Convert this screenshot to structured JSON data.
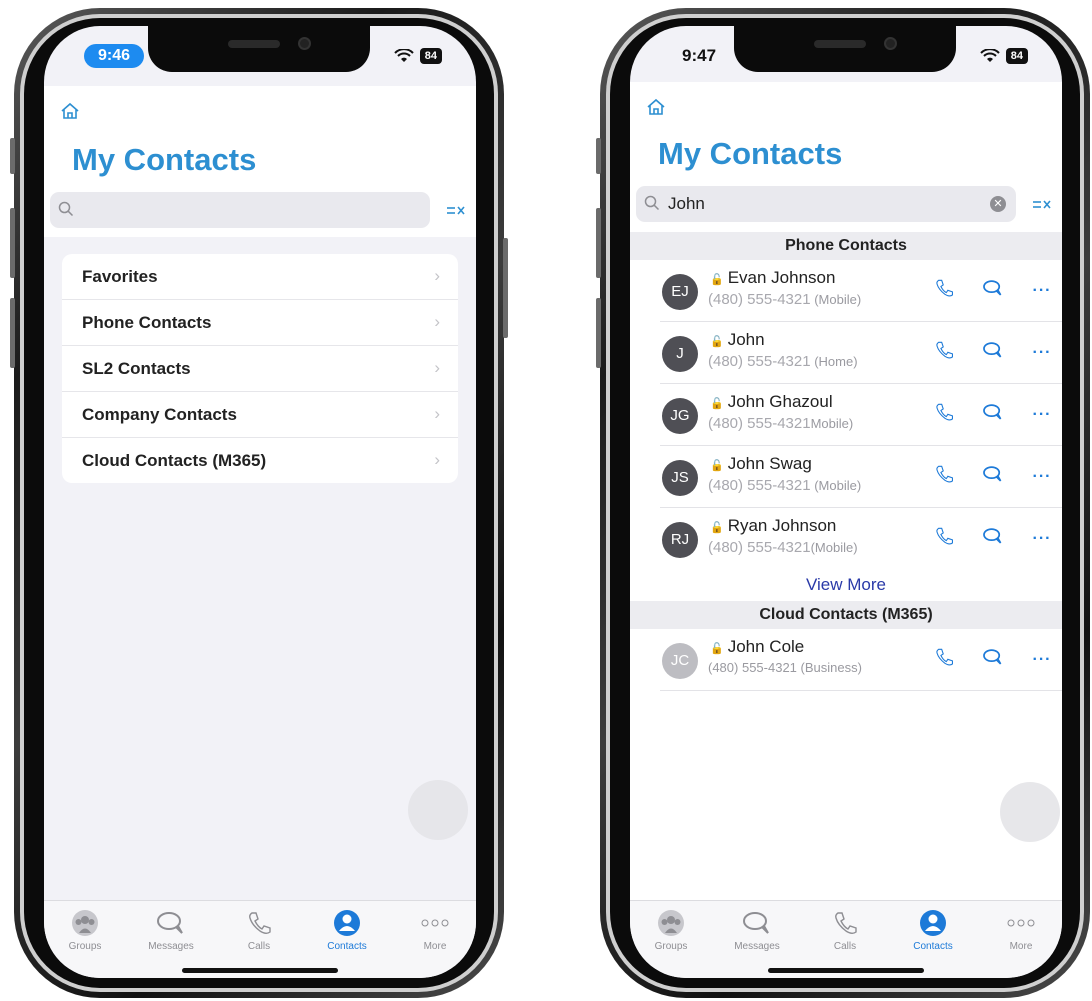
{
  "left_phone": {
    "status": {
      "time": "9:46",
      "battery": "84"
    },
    "title": "My Contacts",
    "search": {
      "value": ""
    },
    "menu": [
      {
        "label": "Favorites"
      },
      {
        "label": "Phone Contacts"
      },
      {
        "label": "SL2 Contacts"
      },
      {
        "label": "Company Contacts"
      },
      {
        "label": "Cloud Contacts (M365)"
      }
    ]
  },
  "right_phone": {
    "status": {
      "time": "9:47",
      "battery": "84"
    },
    "title": "My Contacts",
    "search": {
      "value": "John"
    },
    "sections": [
      {
        "title": "Phone Contacts",
        "contacts": [
          {
            "initials": "EJ",
            "name": "Evan Johnson",
            "phone": "(480) 555-4321",
            "type": "(Mobile)"
          },
          {
            "initials": "J",
            "name": "John",
            "phone": "(480) 555-4321",
            "type": "(Home)"
          },
          {
            "initials": "JG",
            "name": "John Ghazoul",
            "phone": "(480) 555-4321",
            "type": "Mobile)"
          },
          {
            "initials": "JS",
            "name": "John Swag",
            "phone": "(480) 555-4321",
            "type": "(Mobile)"
          },
          {
            "initials": "RJ",
            "name": "Ryan Johnson",
            "phone": "(480) 555-4321",
            "type": "(Mobile)"
          }
        ],
        "view_more": "View More"
      },
      {
        "title": "Cloud Contacts (M365)",
        "contacts": [
          {
            "initials": "JC",
            "name": "John Cole",
            "phone": "(480) 555-4321",
            "type": "(Business)"
          }
        ]
      }
    ]
  },
  "tabbar": [
    {
      "label": "Groups",
      "icon": "groups-icon",
      "active": false
    },
    {
      "label": "Messages",
      "icon": "messages-icon",
      "active": false
    },
    {
      "label": "Calls",
      "icon": "phone-icon",
      "active": false
    },
    {
      "label": "Contacts",
      "icon": "contacts-icon",
      "active": true
    },
    {
      "label": "More",
      "icon": "more-icon",
      "active": false
    }
  ],
  "colors": {
    "accent": "#1d7ad8",
    "title": "#2d8fd1",
    "background": "#f2f2f7"
  }
}
